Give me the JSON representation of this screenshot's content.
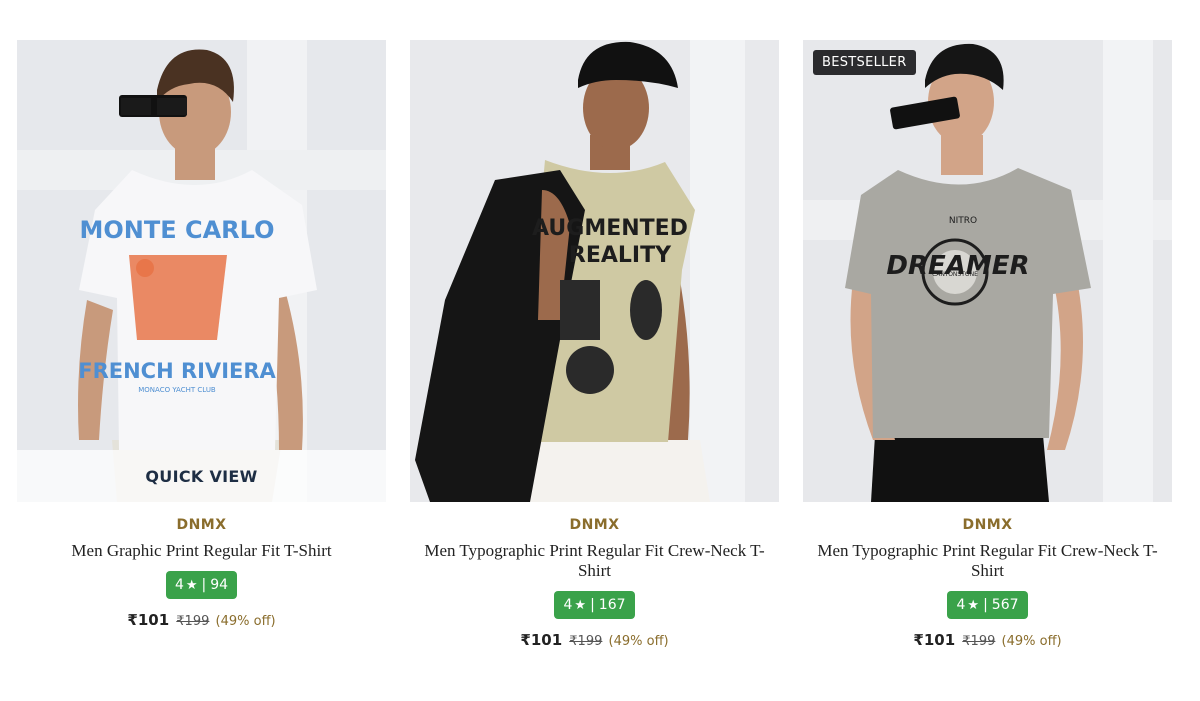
{
  "products": [
    {
      "brand": "DNMX",
      "name": "Men Graphic Print Regular Fit T-Shirt",
      "rating": "4",
      "reviews": "94",
      "price": "₹101",
      "mrp": "₹199",
      "discount": "(49% off)",
      "badge": "",
      "quick_view": "QUICK VIEW",
      "shirt_color": "#f7f7f9",
      "print": {
        "line1": "MONTE CARLO",
        "line2": "FRENCH RIVIERA",
        "line3": "MONACO YACHT CLUB"
      }
    },
    {
      "brand": "DNMX",
      "name": "Men Typographic Print Regular Fit Crew-Neck T-Shirt",
      "rating": "4",
      "reviews": "167",
      "price": "₹101",
      "mrp": "₹199",
      "discount": "(49% off)",
      "badge": "",
      "quick_view": "",
      "shirt_color": "#cfc9a3",
      "print": {
        "line1": "AUGMENTED",
        "line2": "REALITY"
      }
    },
    {
      "brand": "DNMX",
      "name": "Men Typographic Print Regular Fit Crew-Neck T-Shirt",
      "rating": "4",
      "reviews": "567",
      "price": "₹101",
      "mrp": "₹199",
      "discount": "(49% off)",
      "badge": "BESTSELLER",
      "quick_view": "",
      "shirt_color": "#a9a8a2",
      "print": {
        "line1": "DREAMER",
        "line2": "CANYONSTONE",
        "line3": "NITRO"
      }
    }
  ],
  "rating_star": "★",
  "rating_separator": "|"
}
